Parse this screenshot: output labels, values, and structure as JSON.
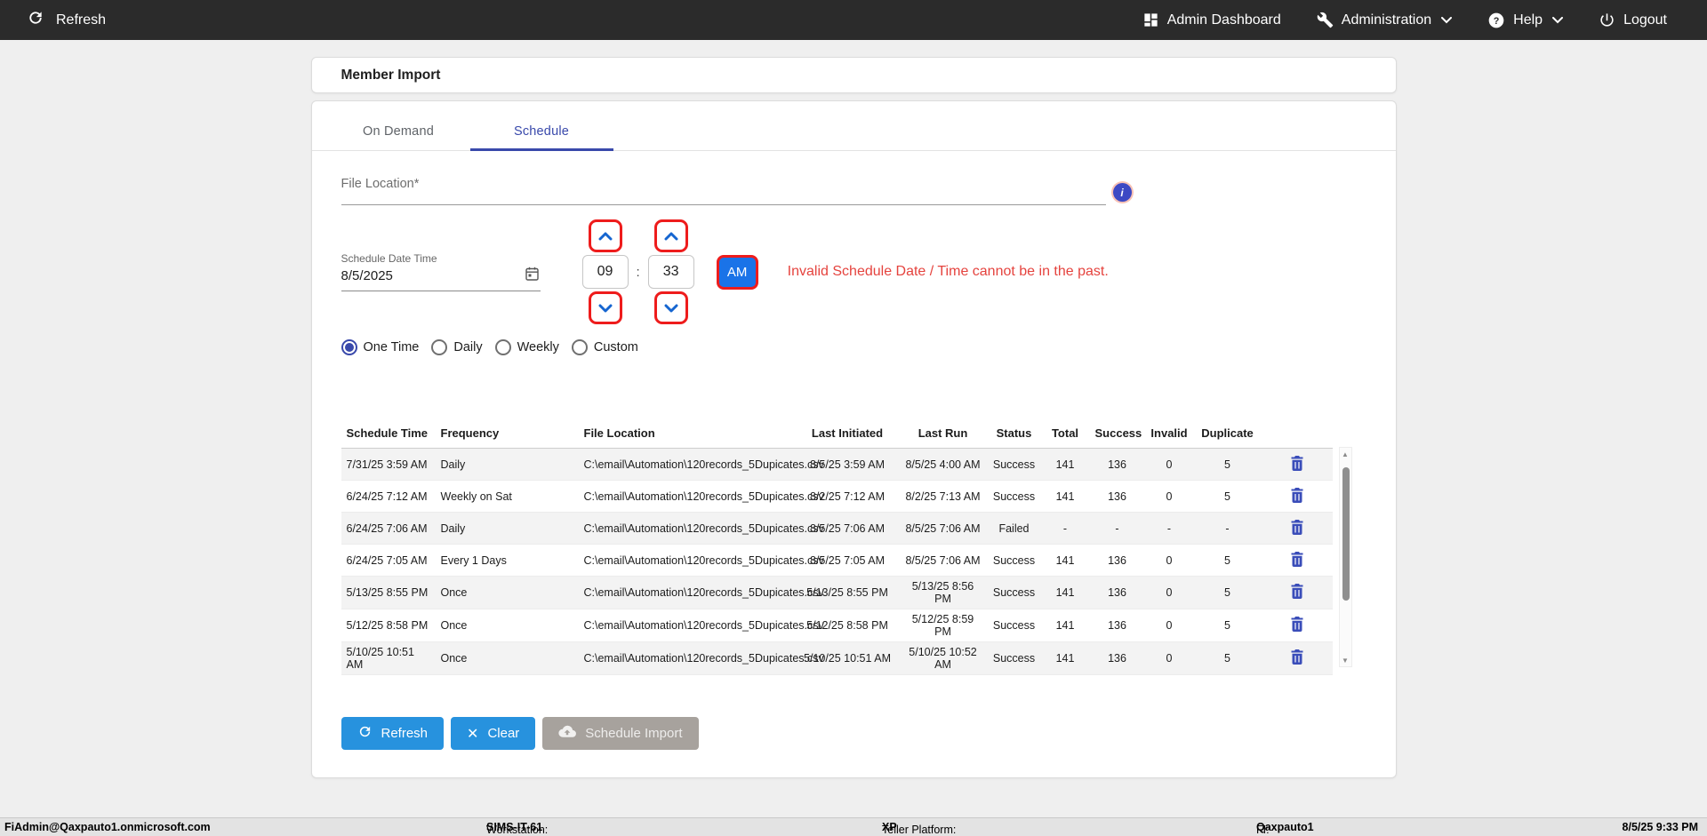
{
  "navbar": {
    "refresh_label": "Refresh",
    "items": [
      {
        "label": "Admin Dashboard",
        "icon": "dashboard-icon",
        "has_dropdown": false
      },
      {
        "label": "Administration",
        "icon": "wrench-icon",
        "has_dropdown": true
      },
      {
        "label": "Help",
        "icon": "help-icon",
        "has_dropdown": true
      },
      {
        "label": "Logout",
        "icon": "power-icon",
        "has_dropdown": false
      }
    ]
  },
  "page": {
    "title": "Member Import"
  },
  "tabs": [
    {
      "label": "On Demand",
      "active": false
    },
    {
      "label": "Schedule",
      "active": true
    }
  ],
  "form": {
    "file_location": {
      "label": "File Location*",
      "value": "",
      "info_icon": "info-icon"
    },
    "schedule_date_time": {
      "label": "Schedule Date Time",
      "value": "8/5/2025",
      "icon": "calendar-icon"
    },
    "time": {
      "hour": "09",
      "minute": "33",
      "separator": ":",
      "meridiem": "AM"
    },
    "error_message": "Invalid Schedule Date / Time cannot be in the past.",
    "recurrence": {
      "options": [
        "One Time",
        "Daily",
        "Weekly",
        "Custom"
      ],
      "selected_index": 0
    }
  },
  "table": {
    "columns": [
      "Schedule Time",
      "Frequency",
      "File Location",
      "Last Initiated",
      "Last Run",
      "Status",
      "Total",
      "Success",
      "Invalid",
      "Duplicate",
      ""
    ],
    "rows": [
      {
        "schedule_time": "7/31/25 3:59 AM",
        "frequency": "Daily",
        "file_location": "C:\\email\\Automation\\120records_5Dupicates.csv",
        "last_initiated": "8/5/25 3:59 AM",
        "last_run": "8/5/25 4:00 AM",
        "status": "Success",
        "total": "141",
        "success": "136",
        "invalid": "0",
        "duplicate": "5"
      },
      {
        "schedule_time": "6/24/25 7:12 AM",
        "frequency": "Weekly on Sat",
        "file_location": "C:\\email\\Automation\\120records_5Dupicates.csv",
        "last_initiated": "8/2/25 7:12 AM",
        "last_run": "8/2/25 7:13 AM",
        "status": "Success",
        "total": "141",
        "success": "136",
        "invalid": "0",
        "duplicate": "5"
      },
      {
        "schedule_time": "6/24/25 7:06 AM",
        "frequency": "Daily",
        "file_location": "C:\\email\\Automation\\120records_5Dupicates.csv",
        "last_initiated": "8/5/25 7:06 AM",
        "last_run": "8/5/25 7:06 AM",
        "status": "Failed",
        "total": "-",
        "success": "-",
        "invalid": "-",
        "duplicate": "-"
      },
      {
        "schedule_time": "6/24/25 7:05 AM",
        "frequency": "Every 1 Days",
        "file_location": "C:\\email\\Automation\\120records_5Dupicates.csv",
        "last_initiated": "8/5/25 7:05 AM",
        "last_run": "8/5/25 7:06 AM",
        "status": "Success",
        "total": "141",
        "success": "136",
        "invalid": "0",
        "duplicate": "5"
      },
      {
        "schedule_time": "5/13/25 8:55 PM",
        "frequency": "Once",
        "file_location": "C:\\email\\Automation\\120records_5Dupicates.csv",
        "last_initiated": "5/13/25 8:55 PM",
        "last_run": "5/13/25 8:56 PM",
        "status": "Success",
        "total": "141",
        "success": "136",
        "invalid": "0",
        "duplicate": "5"
      },
      {
        "schedule_time": "5/12/25 8:58 PM",
        "frequency": "Once",
        "file_location": "C:\\email\\Automation\\120records_5Dupicates.csv",
        "last_initiated": "5/12/25 8:58 PM",
        "last_run": "5/12/25 8:59 PM",
        "status": "Success",
        "total": "141",
        "success": "136",
        "invalid": "0",
        "duplicate": "5"
      },
      {
        "schedule_time": "5/10/25 10:51 AM",
        "frequency": "Once",
        "file_location": "C:\\email\\Automation\\120records_5Dupicates.csv",
        "last_initiated": "5/10/25 10:51 AM",
        "last_run": "5/10/25 10:52 AM",
        "status": "Success",
        "total": "141",
        "success": "136",
        "invalid": "0",
        "duplicate": "5"
      }
    ],
    "row_action_icon": "trash-icon"
  },
  "actions": {
    "refresh": "Refresh",
    "clear": "Clear",
    "schedule_import": "Schedule Import"
  },
  "footer": {
    "user": "FiAdmin@Qaxpauto1.onmicrosoft.com",
    "workstation_label": "Workstation: ",
    "workstation": "SIMS-IT-61",
    "teller_label": "Teller Platform: ",
    "teller": "XP",
    "fi_label": "FI: ",
    "fi": "Qaxpauto1",
    "datetime": "8/5/25 9:33 PM"
  },
  "colors": {
    "navbar_bg": "#2b2b2b",
    "accent_indigo": "#3949ab",
    "spinner_blue": "#1565d0",
    "meridiem_bg": "#1a73e8",
    "focus_ring_red": "#ee1c1c",
    "error_red": "#e5433e",
    "button_blue": "#2792de",
    "button_disabled": "#a7a29d",
    "row_stripe": "#f3f3f3"
  }
}
